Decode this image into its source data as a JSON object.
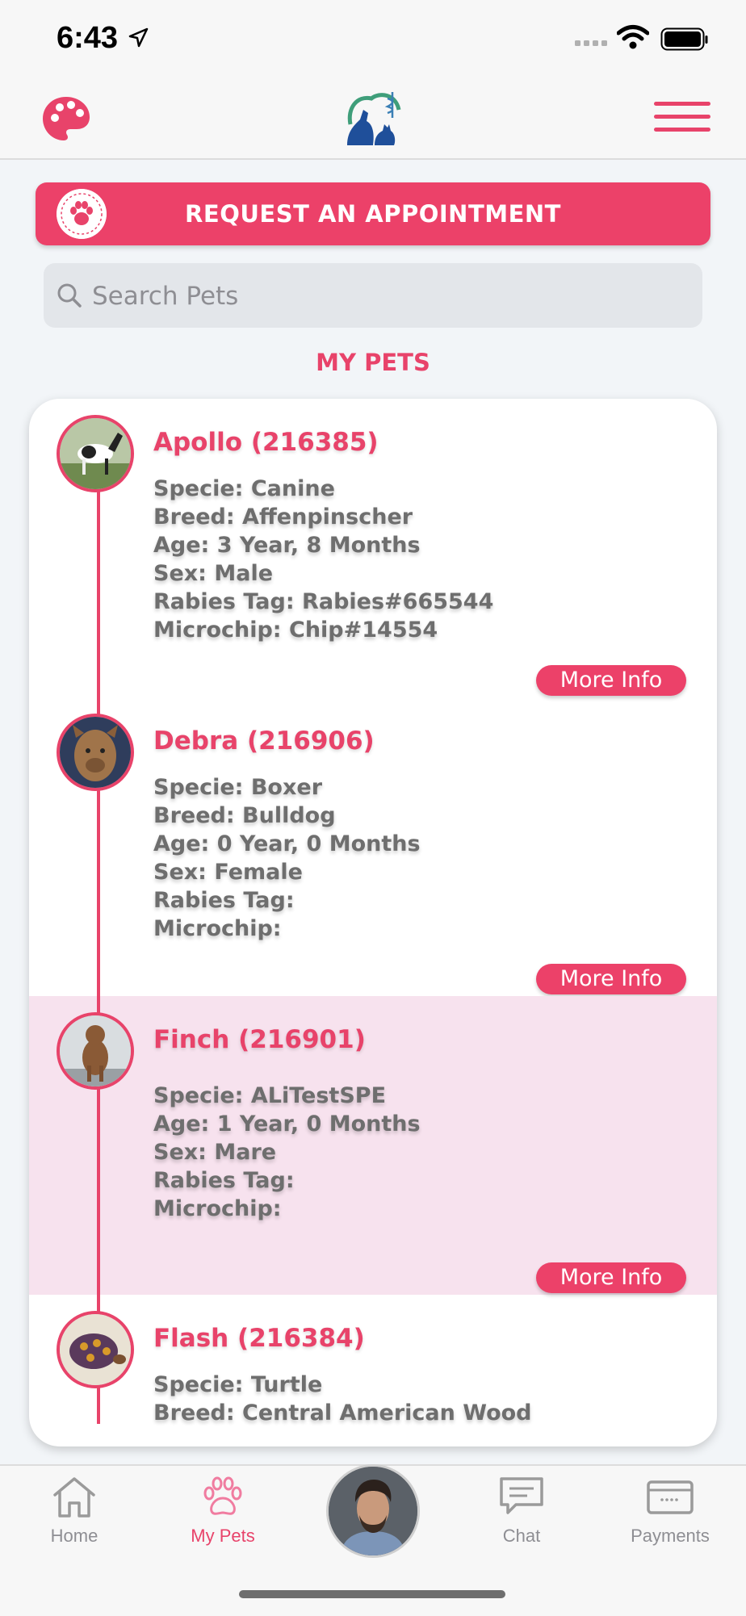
{
  "status_bar": {
    "time": "6:43"
  },
  "header": {
    "logo_alt": "clinic logo"
  },
  "appointment": {
    "label": "REQUEST AN APPOINTMENT"
  },
  "search": {
    "placeholder": "Search Pets"
  },
  "section": {
    "title": "MY PETS"
  },
  "pets": [
    {
      "name": "Apollo (216385)",
      "lines": [
        "Specie: Canine",
        "Breed: Affenpinscher",
        "Age: 3 Year, 8 Months",
        "Sex: Male",
        "Rabies Tag: Rabies#665544",
        "Microchip: Chip#14554"
      ],
      "more_label": "More Info"
    },
    {
      "name": "Debra (216906)",
      "lines": [
        "Specie: Boxer",
        "Breed: Bulldog",
        "Age: 0 Year, 0 Months",
        "Sex: Female",
        "Rabies Tag:",
        "Microchip:"
      ],
      "more_label": "More Info"
    },
    {
      "name": "Finch (216901)",
      "lines": [
        "",
        "Specie: ALiTestSPE",
        "Age: 1 Year, 0 Months",
        "Sex: Mare",
        "Rabies Tag:",
        "Microchip:"
      ],
      "more_label": "More Info"
    },
    {
      "name": "Flash (216384)",
      "lines": [
        "Specie: Turtle",
        "Breed: Central American Wood"
      ],
      "more_label": ""
    }
  ],
  "tabbar": {
    "tabs": [
      {
        "label": "Home",
        "icon": "house-icon"
      },
      {
        "label": "My Pets",
        "icon": "paw-icon"
      },
      {
        "label": "",
        "icon": "profile-avatar"
      },
      {
        "label": "Chat",
        "icon": "chat-icon"
      },
      {
        "label": "Payments",
        "icon": "card-icon"
      }
    ],
    "active": "My Pets"
  },
  "colors": {
    "accent": "#e8436a",
    "highlight_row": "#f7e2ee",
    "text_gray": "#6e6e6e"
  }
}
